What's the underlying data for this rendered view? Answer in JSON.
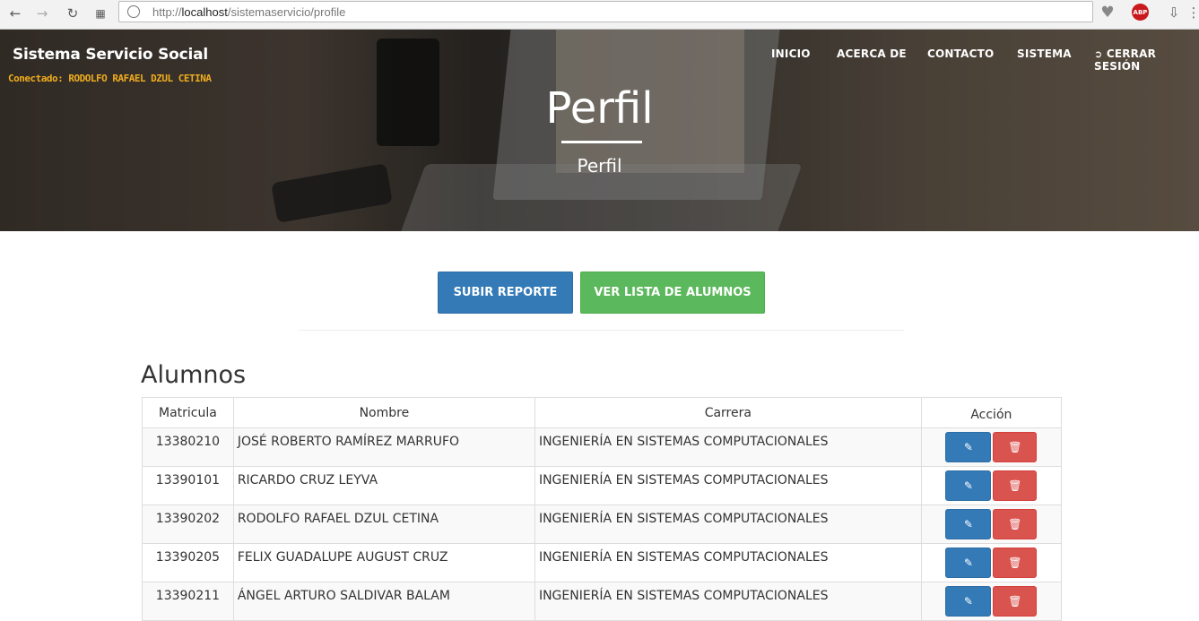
{
  "browser": {
    "url_prefix": "http://",
    "url_host": "localhost",
    "url_path": "/sistemaservicio/profile",
    "abp_label": "ABP"
  },
  "header": {
    "brand": "Sistema Servicio Social",
    "connected": "Conectado: RODOLFO RAFAEL DZUL CETINA",
    "menu": [
      "INICIO",
      "ACERCA DE",
      "CONTACTO",
      "SISTEMA",
      "CERRAR SESIÓN"
    ],
    "title": "Perfil",
    "subtitle": "Perfil"
  },
  "actions": {
    "upload": "SUBIR REPORTE",
    "list": "VER LISTA DE ALUMNOS"
  },
  "students": {
    "title": "Alumnos",
    "columns": [
      "Matricula",
      "Nombre",
      "Carrera",
      "Acción"
    ],
    "rows": [
      {
        "matricula": "13380210",
        "nombre": "JOSÉ ROBERTO RAMÍREZ MARRUFO",
        "carrera": "INGENIERÍA EN SISTEMAS COMPUTACIONALES"
      },
      {
        "matricula": "13390101",
        "nombre": "RICARDO CRUZ LEYVA",
        "carrera": "INGENIERÍA EN SISTEMAS COMPUTACIONALES"
      },
      {
        "matricula": "13390202",
        "nombre": "RODOLFO RAFAEL DZUL CETINA",
        "carrera": "INGENIERÍA EN SISTEMAS COMPUTACIONALES"
      },
      {
        "matricula": "13390205",
        "nombre": "FELIX GUADALUPE AUGUST CRUZ",
        "carrera": "INGENIERÍA EN SISTEMAS COMPUTACIONALES"
      },
      {
        "matricula": "13390211",
        "nombre": "ÁNGEL ARTURO SALDIVAR BALAM",
        "carrera": "INGENIERÍA EN SISTEMAS COMPUTACIONALES"
      }
    ]
  },
  "colors": {
    "primary": "#337ab7",
    "success": "#5cb85c",
    "danger": "#d9534f",
    "connected": "#f0ad1e"
  }
}
